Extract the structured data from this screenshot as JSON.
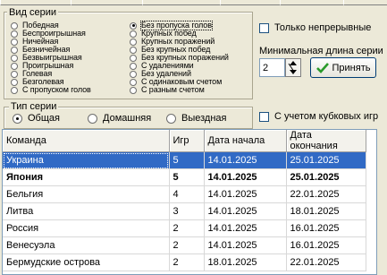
{
  "series_group": {
    "legend": "Вид серии",
    "left_column": [
      {
        "label": "Победная",
        "selected": false
      },
      {
        "label": "Беспроигрышная",
        "selected": false
      },
      {
        "label": "Ничейная",
        "selected": false
      },
      {
        "label": "Безничейная",
        "selected": false
      },
      {
        "label": "Безвыигрышная",
        "selected": false
      },
      {
        "label": "Проигрышная",
        "selected": false
      },
      {
        "label": "Голевая",
        "selected": false
      },
      {
        "label": "Безголевая",
        "selected": false
      },
      {
        "label": "С пропуском голов",
        "selected": false
      }
    ],
    "right_column": [
      {
        "label": "Без пропуска голов",
        "selected": true
      },
      {
        "label": "Крупных побед",
        "selected": false
      },
      {
        "label": "Крупных поражений",
        "selected": false
      },
      {
        "label": "Без крупных побед",
        "selected": false
      },
      {
        "label": "Без крупных поражений",
        "selected": false
      },
      {
        "label": "С удалениями",
        "selected": false
      },
      {
        "label": "Без удалений",
        "selected": false
      },
      {
        "label": "С одинаковым счетом",
        "selected": false
      },
      {
        "label": "С разным счетом",
        "selected": false
      }
    ]
  },
  "only_continuous": {
    "label": "Только непрерывные",
    "checked": false
  },
  "min_length": {
    "label": "Минимальная длина серии",
    "value": "2"
  },
  "accept_button": {
    "label": "Принять"
  },
  "type_group": {
    "legend": "Тип серии",
    "options": [
      {
        "label": "Общая",
        "selected": true
      },
      {
        "label": "Домашняя",
        "selected": false
      },
      {
        "label": "Выездная",
        "selected": false
      }
    ]
  },
  "cup_games": {
    "label": "С учетом кубковых игр",
    "checked": false
  },
  "table": {
    "columns": [
      "Команда",
      "Игр",
      "Дата начала",
      "Дата окончания"
    ],
    "rows": [
      [
        "Украина",
        "5",
        "14.01.2025",
        "25.01.2025"
      ],
      [
        "Япония",
        "5",
        "14.01.2025",
        "25.01.2025"
      ],
      [
        "Бельгия",
        "4",
        "14.01.2025",
        "22.01.2025"
      ],
      [
        "Литва",
        "3",
        "14.01.2025",
        "18.01.2025"
      ],
      [
        "Россия",
        "2",
        "14.01.2025",
        "16.01.2025"
      ],
      [
        "Венесуэла",
        "2",
        "14.01.2025",
        "16.01.2025"
      ],
      [
        "Бермудские острова",
        "2",
        "18.01.2025",
        "22.01.2025"
      ]
    ],
    "selected_row": 0,
    "bold_row": 1
  },
  "colors": {
    "selection": "#316ac5",
    "check_green": "#2a9a2a"
  }
}
